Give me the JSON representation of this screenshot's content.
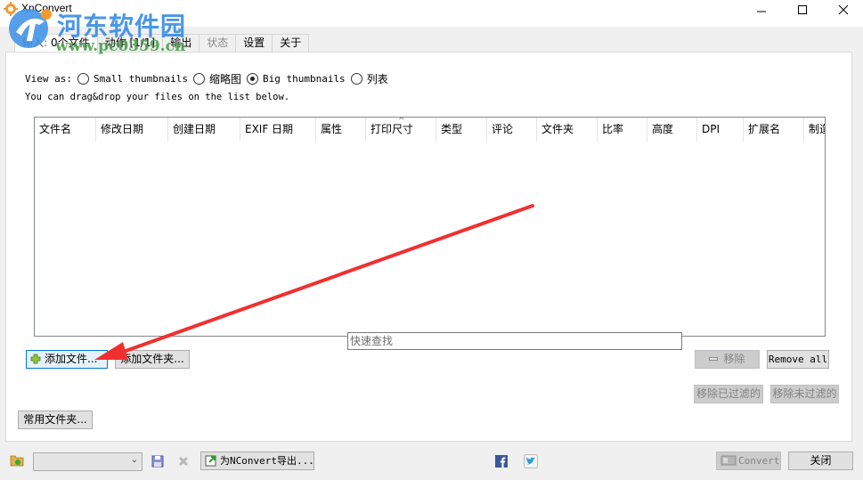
{
  "window": {
    "title": "XnConvert",
    "controls": {
      "minimize": "minimize-icon",
      "maximize": "maximize-icon",
      "close": "close-icon"
    }
  },
  "watermark": {
    "site_name": "河东软件园",
    "url": "www.pc0359.cn"
  },
  "tabs": [
    {
      "prefix": "输入:",
      "label": "0个文件",
      "state": "active"
    },
    {
      "label": "动作 [1/1]",
      "state": "normal"
    },
    {
      "label": "输出",
      "state": "normal"
    },
    {
      "label": "状态",
      "state": "disabled"
    },
    {
      "label": "设置",
      "state": "normal"
    },
    {
      "label": "关于",
      "state": "normal"
    }
  ],
  "view_as": {
    "label": "View as:",
    "options": [
      {
        "label": "Small thumbnails",
        "selected": false
      },
      {
        "label": "缩略图",
        "selected": false
      },
      {
        "label": "Big thumbnails",
        "selected": true
      },
      {
        "label": "列表",
        "selected": false
      }
    ]
  },
  "hint": "You can drag&drop your files on the list below.",
  "file_list": {
    "columns": [
      "文件名",
      "修改日期",
      "创建日期",
      "EXIF 日期",
      "属性",
      "打印尺寸",
      "类型",
      "评论",
      "文件夹",
      "比率",
      "高度",
      "DPI",
      "扩展名",
      "制造"
    ],
    "sorted_column": "打印尺寸",
    "rows": []
  },
  "buttons": {
    "add_files": "添加文件...",
    "add_folder": "添加文件夹...",
    "remove": "移除",
    "remove_all": "Remove all",
    "remove_filtered": "移除已过滤的",
    "remove_unfiltered": "移除未过滤的",
    "favorite_folders": "常用文件夹...",
    "export_nconvert": "为NConvert导出...",
    "convert": "Convert",
    "close": "关闭"
  },
  "search": {
    "placeholder": "快速查找",
    "value": ""
  },
  "bottom": {
    "preset_value": "",
    "icons": [
      "folder-load-icon",
      "save-icon",
      "delete-icon",
      "export-icon",
      "facebook-icon",
      "twitter-icon"
    ]
  },
  "colors": {
    "annotation_arrow": "#f03030",
    "focus_border": "#0078d7",
    "watermark_blue": "#3a8ee6",
    "watermark_green": "#4aa04a"
  }
}
